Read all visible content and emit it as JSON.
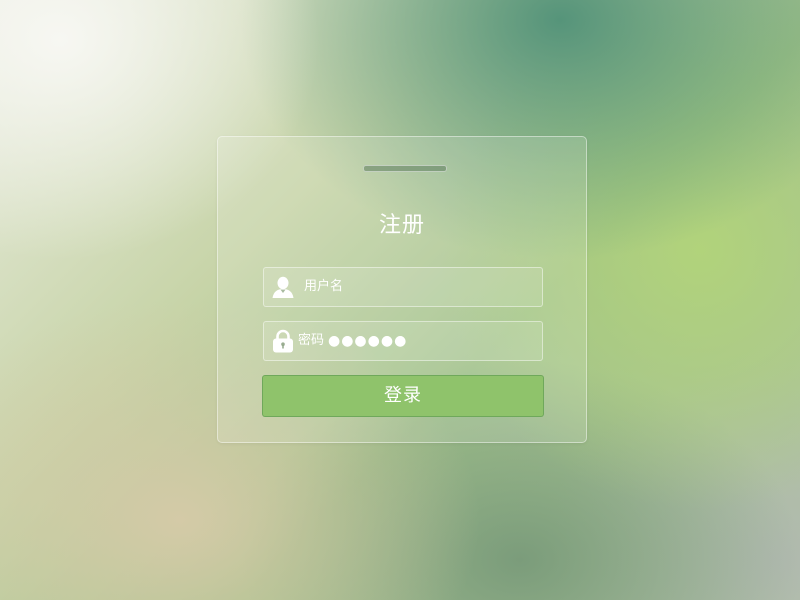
{
  "form": {
    "title": "注册",
    "username": {
      "placeholder": "用户名",
      "icon": "user-icon"
    },
    "password": {
      "label": "密码",
      "value": "●●●●●●",
      "icon": "lock-icon"
    },
    "submit_label": "登录"
  },
  "colors": {
    "button": "#8fc36b",
    "text": "#ffffff"
  }
}
